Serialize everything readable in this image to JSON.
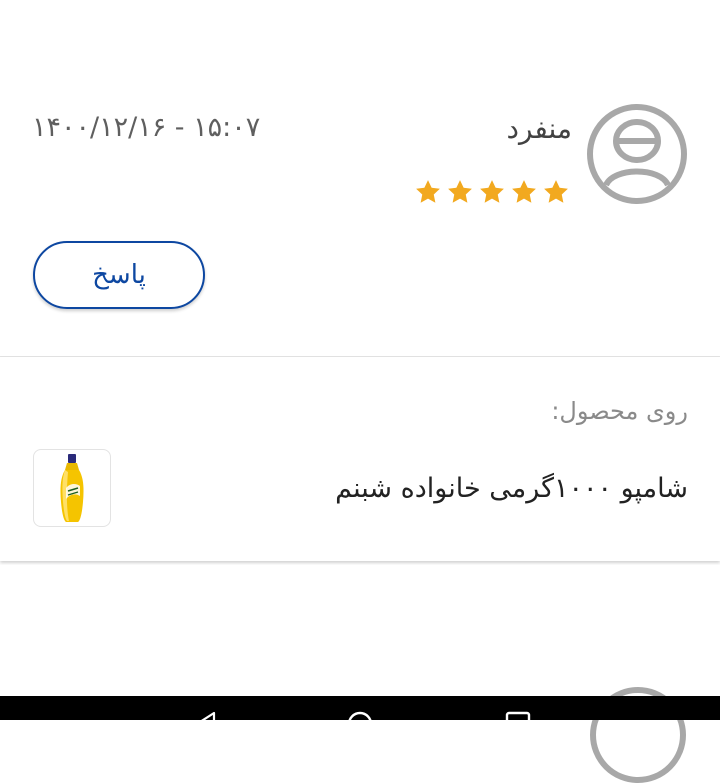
{
  "review": {
    "author": "منفرد",
    "datetime": "۱۴۰۰/۱۲/۱۶ - ۱۵:۰۷",
    "rating": 5,
    "rating_max": 5,
    "reply_label": "پاسخ"
  },
  "product": {
    "caption": "روی محصول:",
    "name": "شامپو ۱۰۰۰گرمی خانواده شبنم"
  },
  "colors": {
    "accent": "#0d47a1",
    "star": "#f2a91f",
    "avatar": "#a8a8a8"
  },
  "icons": {
    "avatar": "user-circle-icon",
    "star": "star-icon",
    "nav_back": "back-icon",
    "nav_home": "home-icon",
    "nav_recent": "recent-apps-icon"
  }
}
